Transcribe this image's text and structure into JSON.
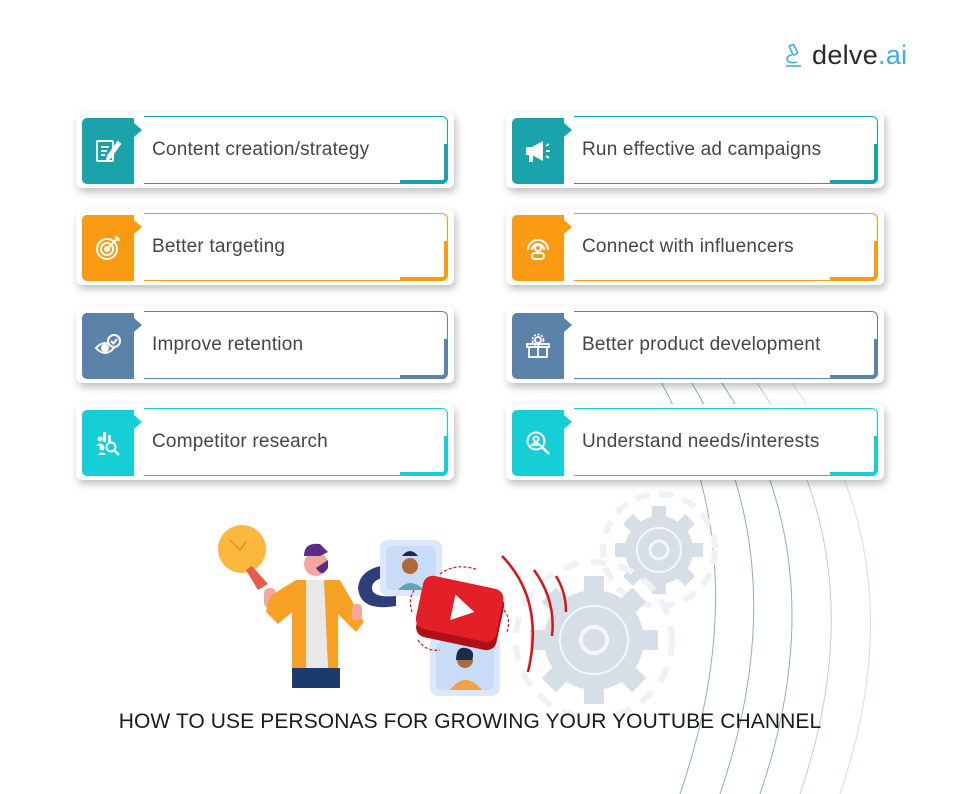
{
  "brand": {
    "name_main": "delve",
    "name_suffix": ".ai",
    "accent_color": "#3ab0e2"
  },
  "colors": {
    "teal": "#1ba3ab",
    "orange": "#fb9a13",
    "slate": "#5b83aa",
    "cyan": "#15ced6"
  },
  "cards": [
    {
      "label": "Content creation/strategy",
      "icon": "content-edit-icon",
      "color": "teal"
    },
    {
      "label": "Run effective ad campaigns",
      "icon": "megaphone-icon",
      "color": "teal"
    },
    {
      "label": "Better targeting",
      "icon": "target-icon",
      "color": "orange"
    },
    {
      "label": "Connect with influencers",
      "icon": "influencer-broadcast-icon",
      "color": "orange"
    },
    {
      "label": "Improve retention",
      "icon": "eye-check-icon",
      "color": "slate"
    },
    {
      "label": "Better product development",
      "icon": "product-box-gear-icon",
      "color": "slate"
    },
    {
      "label": "Competitor research",
      "icon": "competitor-analysis-icon",
      "color": "cyan"
    },
    {
      "label": "Understand needs/interests",
      "icon": "user-search-icon",
      "color": "cyan"
    }
  ],
  "illustration": {
    "description": "Man holding lightbulb using a magnet to attract personas toward a YouTube play button, with gears and signal waves",
    "elements": [
      "lightbulb",
      "man",
      "magnet",
      "persona-card-top",
      "youtube-play-button",
      "persona-card-bottom",
      "gear-large",
      "gear-small",
      "signal-waves"
    ]
  },
  "footer": {
    "title": "HOW TO USE PERSONAS FOR GROWING YOUR YOUTUBE CHANNEL"
  }
}
